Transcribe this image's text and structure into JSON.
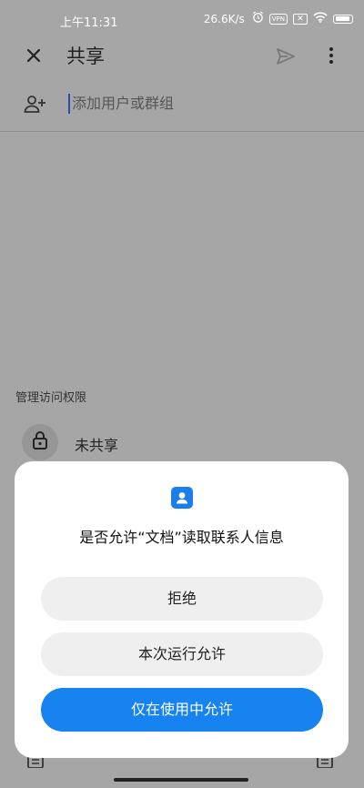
{
  "status_bar": {
    "time": "上午11:31",
    "net_speed": "26.6K/s",
    "vpn": "VPN"
  },
  "app_bar": {
    "title": "共享",
    "icons": [
      "close-icon",
      "send-icon",
      "more-vert-icon"
    ]
  },
  "add_people": {
    "placeholder": "添加用户或群组",
    "icon": "person-add-icon"
  },
  "access": {
    "heading": "管理访问权限",
    "status_label": "未共享",
    "status_icon": "lock-icon"
  },
  "permission_dialog": {
    "icon": "contacts-icon",
    "message": "是否允许“文档”读取联系人信息",
    "buttons": {
      "deny": "拒绝",
      "allow_once": "本次运行允许",
      "allow_while_using": "仅在使用中允许"
    }
  },
  "colors": {
    "scrim_background": "#a6a6a6",
    "dialog_background": "#ffffff",
    "primary_button": "#1683f0",
    "secondary_button": "#efefef",
    "contacts_icon": "#1c7ee8"
  }
}
